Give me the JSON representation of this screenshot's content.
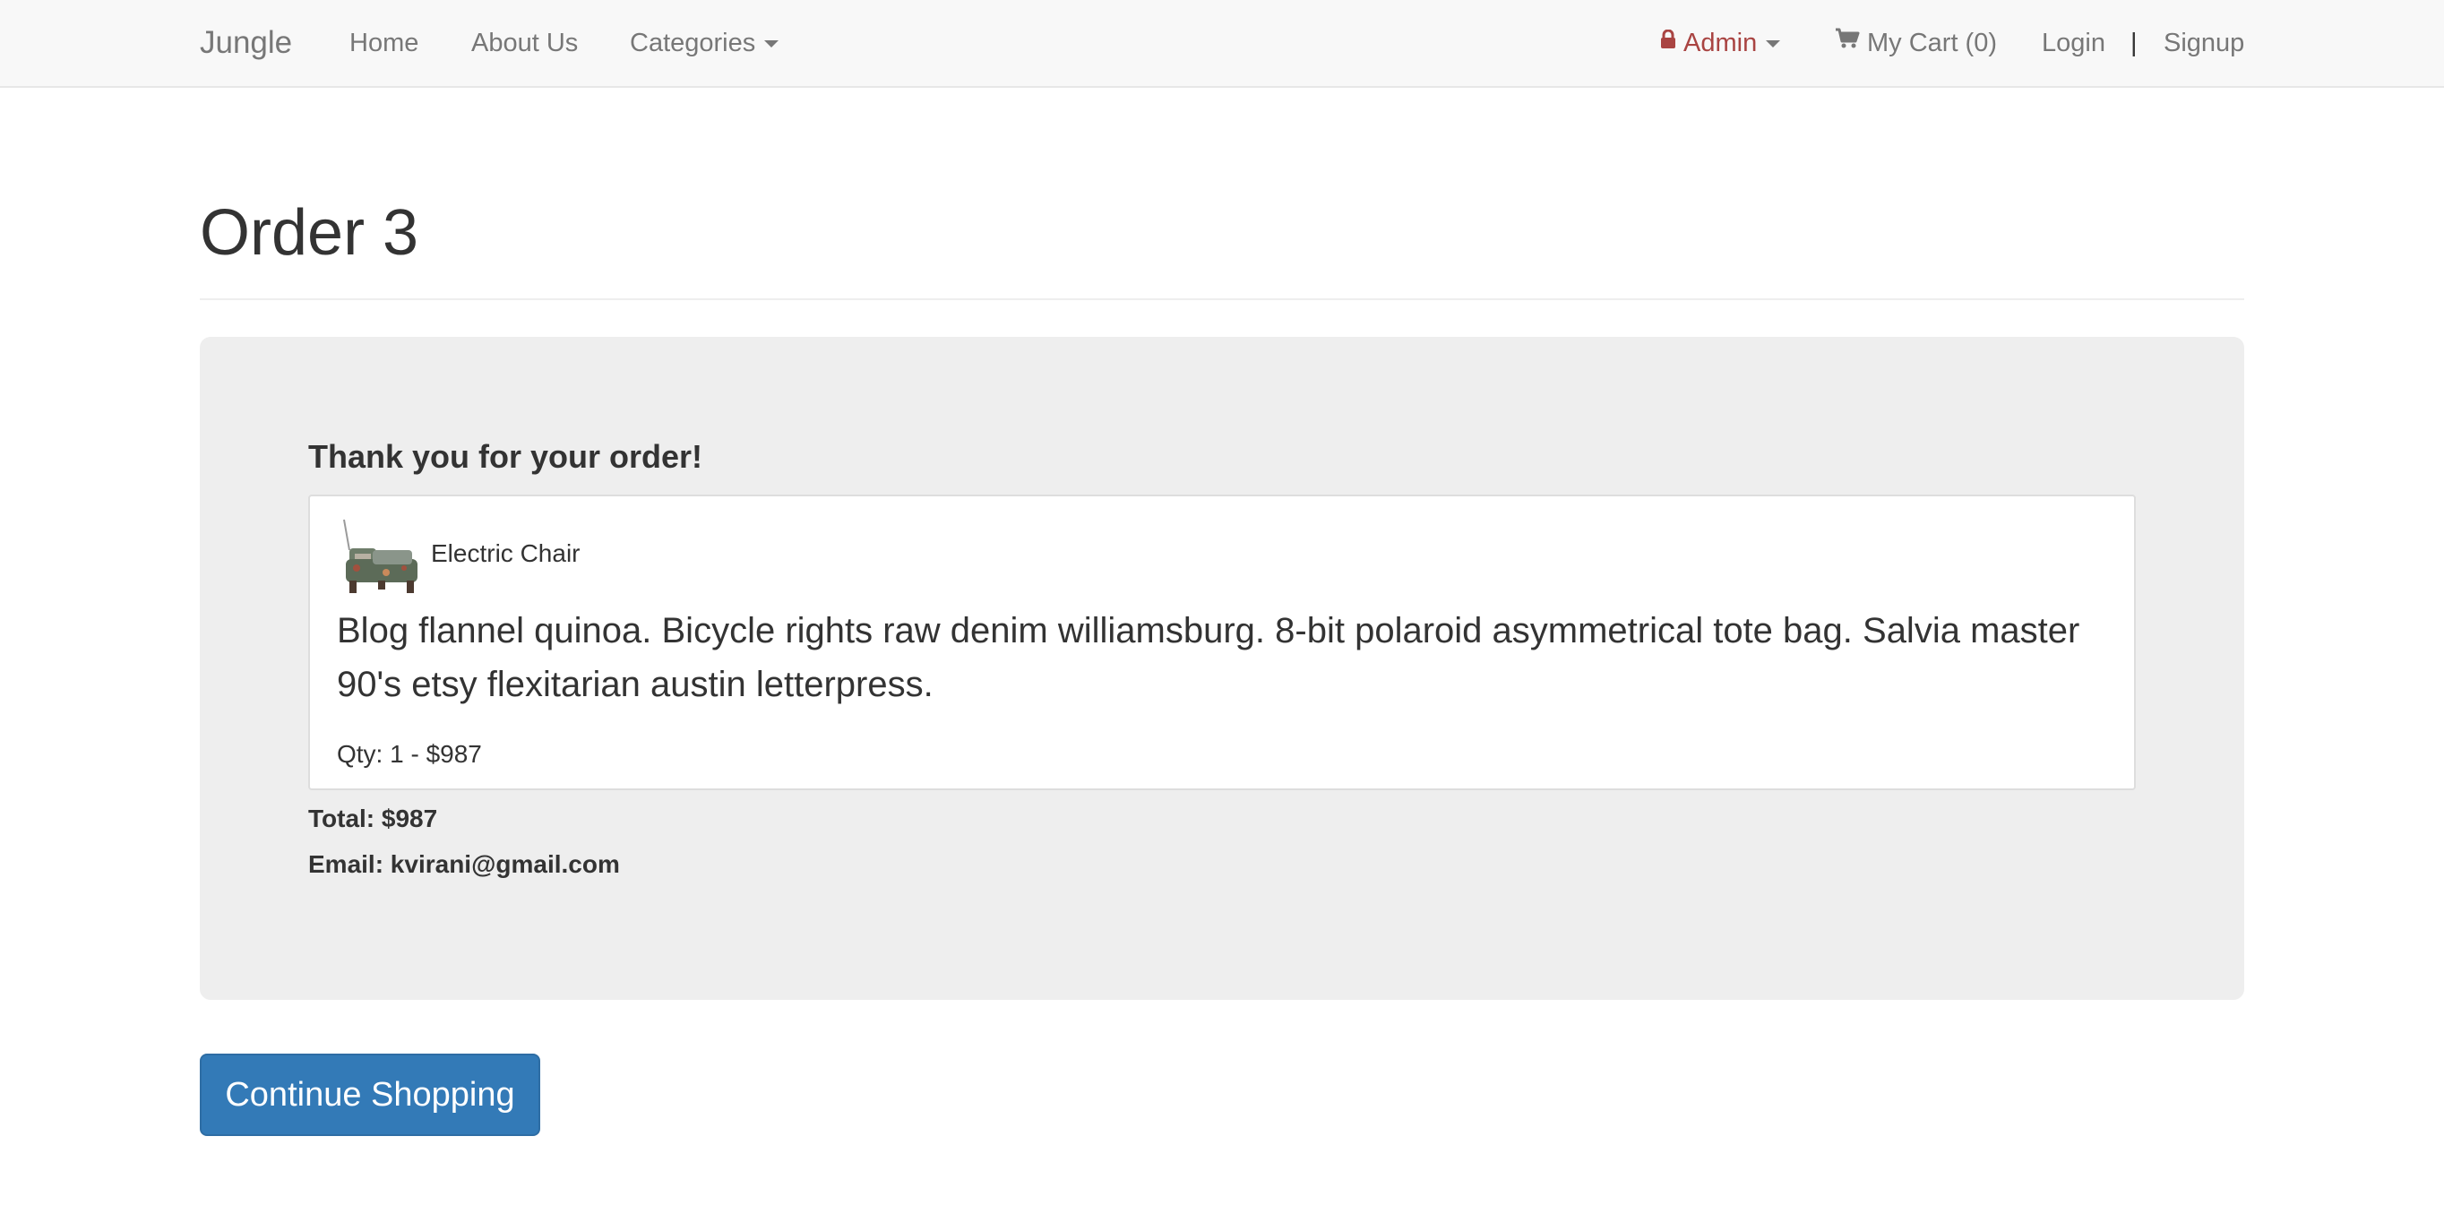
{
  "navbar": {
    "brand": "Jungle",
    "home": "Home",
    "about": "About Us",
    "categories": "Categories",
    "admin": "Admin",
    "cart": "My Cart (0)",
    "login": "Login",
    "separator": "|",
    "signup": "Signup",
    "admin_color": "#a94442"
  },
  "icons": {
    "admin": "lock-icon",
    "cart": "shopping-cart-icon",
    "dropdown": "caret-down-icon"
  },
  "page": {
    "title": "Order 3"
  },
  "order": {
    "thanks": "Thank you for your order!",
    "items": [
      {
        "name": "Electric Chair",
        "description": "Blog flannel quinoa. Bicycle rights raw denim williamsburg. 8-bit polaroid asymmetrical tote bag. Salvia master 90's etsy flexitarian austin letterpress.",
        "qty_line": "Qty: 1 - $987"
      }
    ],
    "total": "Total: $987",
    "email": "Email: kvirani@gmail.com"
  },
  "actions": {
    "continue_label": "Continue Shopping",
    "primary_color": "#337ab7"
  }
}
